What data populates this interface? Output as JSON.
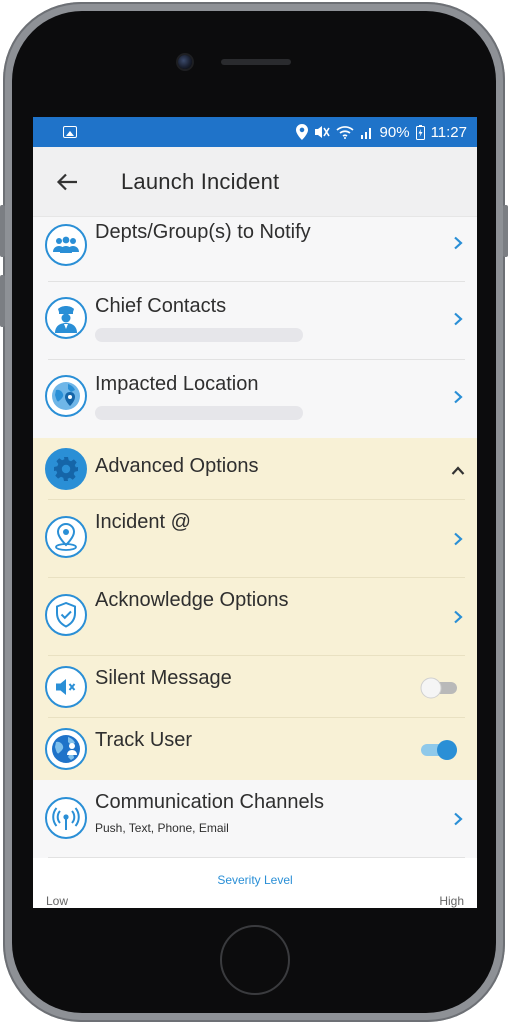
{
  "status_bar": {
    "battery": "90%",
    "time": "11:27"
  },
  "app_bar": {
    "title": "Launch Incident"
  },
  "items": [
    {
      "title": "Depts/Group(s) to Notify",
      "icon": "group-icon"
    },
    {
      "title": "Chief Contacts",
      "icon": "officer-icon"
    },
    {
      "title": "Impacted Location",
      "icon": "globe-pin-icon"
    }
  ],
  "advanced": {
    "title": "Advanced Options",
    "icon": "gear-icon",
    "items": [
      {
        "title": "Incident @",
        "icon": "location-pin-icon"
      },
      {
        "title": "Acknowledge Options",
        "icon": "shield-check-icon"
      },
      {
        "title": "Silent Message",
        "icon": "speaker-mute-icon",
        "toggle": false
      },
      {
        "title": "Track User",
        "icon": "globe-user-icon",
        "toggle": true
      }
    ]
  },
  "communication": {
    "title": "Communication Channels",
    "subtitle": "Push, Text, Phone, Email",
    "icon": "antenna-icon"
  },
  "severity": {
    "label": "Severity Level",
    "low": "Low",
    "high": "High"
  },
  "colors": {
    "accent": "#2a8fd6",
    "status_bar": "#1f73c9",
    "advanced_bg": "#f8f1d6"
  }
}
